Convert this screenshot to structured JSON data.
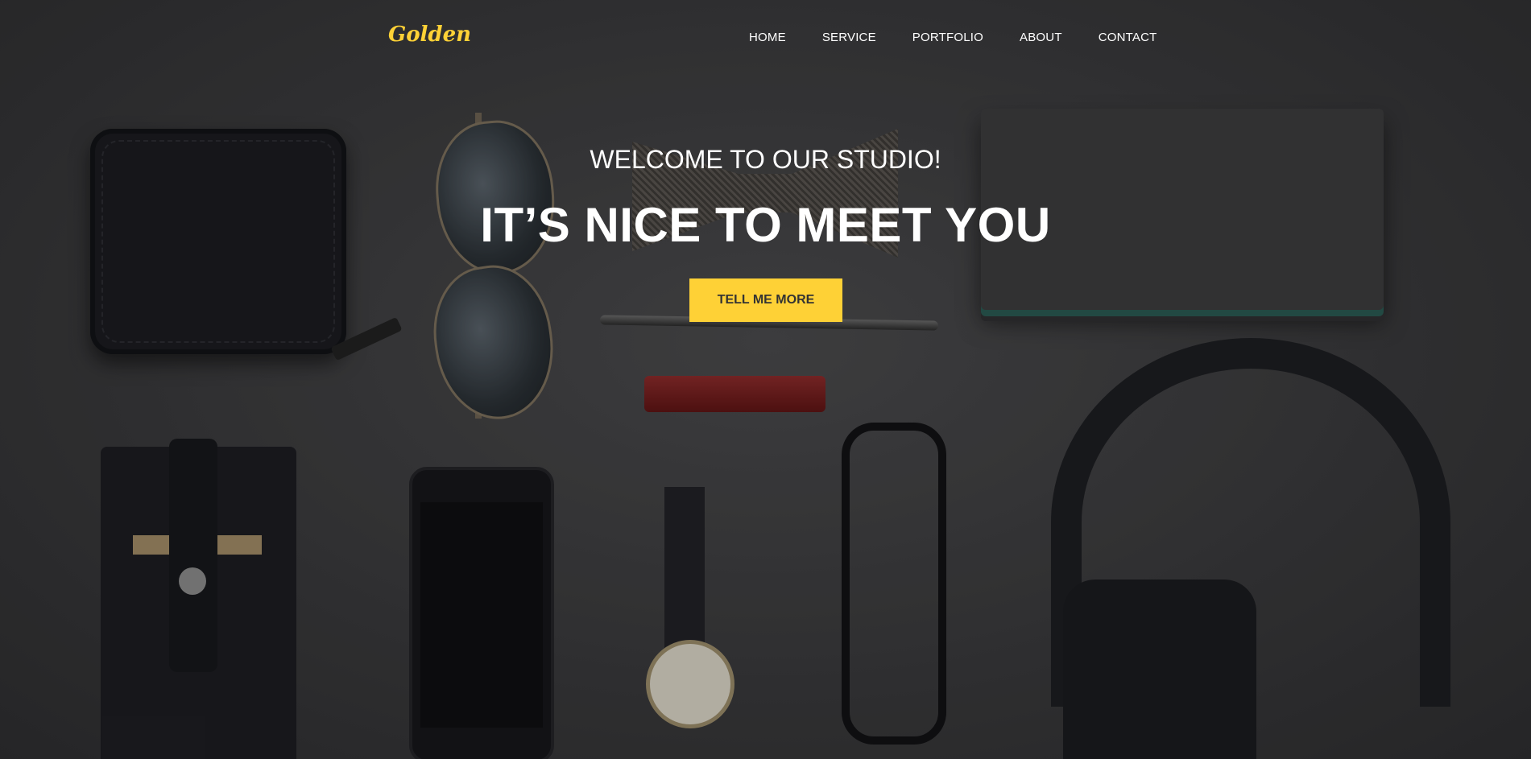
{
  "brand": {
    "logo_text": "Golden",
    "accent_color": "#fed136"
  },
  "nav": {
    "items": [
      {
        "label": "HOME"
      },
      {
        "label": "SERVICE"
      },
      {
        "label": "PORTFOLIO"
      },
      {
        "label": "ABOUT"
      },
      {
        "label": "CONTACT"
      }
    ]
  },
  "hero": {
    "lead": "WELCOME TO OUR STUDIO!",
    "heading": "IT’S NICE TO MEET YOU",
    "cta_label": "TELL ME MORE",
    "background_image": "flat-lay-dark-accessories"
  }
}
